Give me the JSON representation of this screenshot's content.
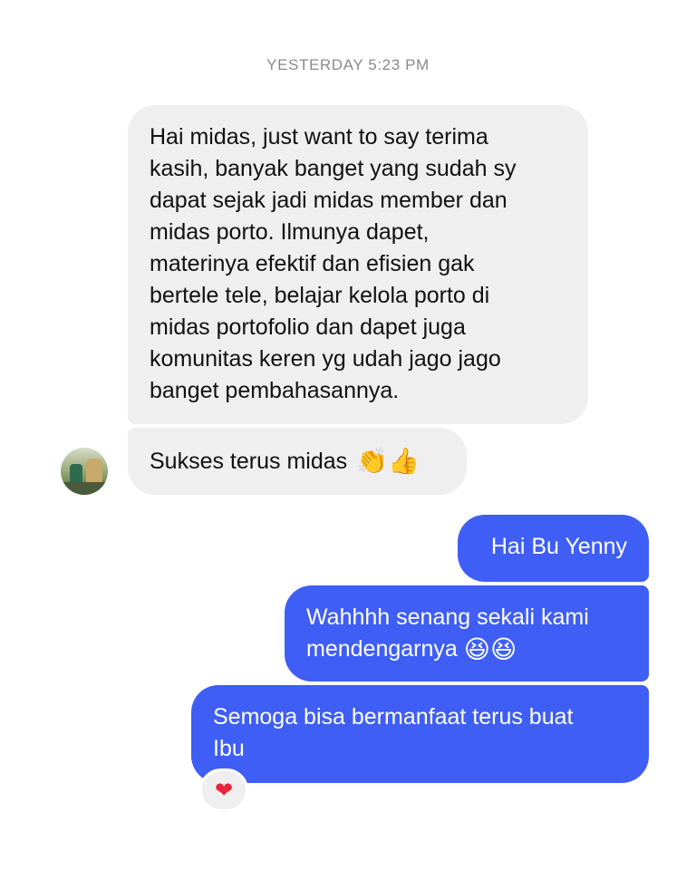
{
  "thread": {
    "timestamp": "YESTERDAY 5:23 PM"
  },
  "incoming": [
    {
      "text": "Hai midas, just want to say terima\nkasih, banyak banget yang sudah sy\ndapat sejak jadi midas member dan\nmidas porto. Ilmunya dapet,\nmaterinya efektif dan efisien gak\nbertele tele, belajar kelola porto di\nmidas portofolio dan dapet juga\nkomunitas keren yg udah jago jago\nbanget pembahasannya."
    },
    {
      "text": "Sukses terus midas",
      "emojis": [
        "👏",
        "👍"
      ],
      "emoji_names": [
        "clapping-hands-icon",
        "thumbs-up-icon"
      ]
    }
  ],
  "outgoing": [
    {
      "text": "Hai Bu Yenny"
    },
    {
      "text": "Wahhhh senang sekali kami\nmendengarnya",
      "emojis": [
        "😆",
        "😆"
      ]
    },
    {
      "text": "Semoga bisa bermanfaat terus buat\nIbu"
    }
  ],
  "reaction": {
    "glyph": "❤",
    "icon": "red-heart-icon"
  },
  "colors": {
    "incoming_bg": "#efefef",
    "outgoing_bg": "#3f5ef6",
    "timestamp": "#8a8a8e",
    "heart": "#e8233a"
  }
}
